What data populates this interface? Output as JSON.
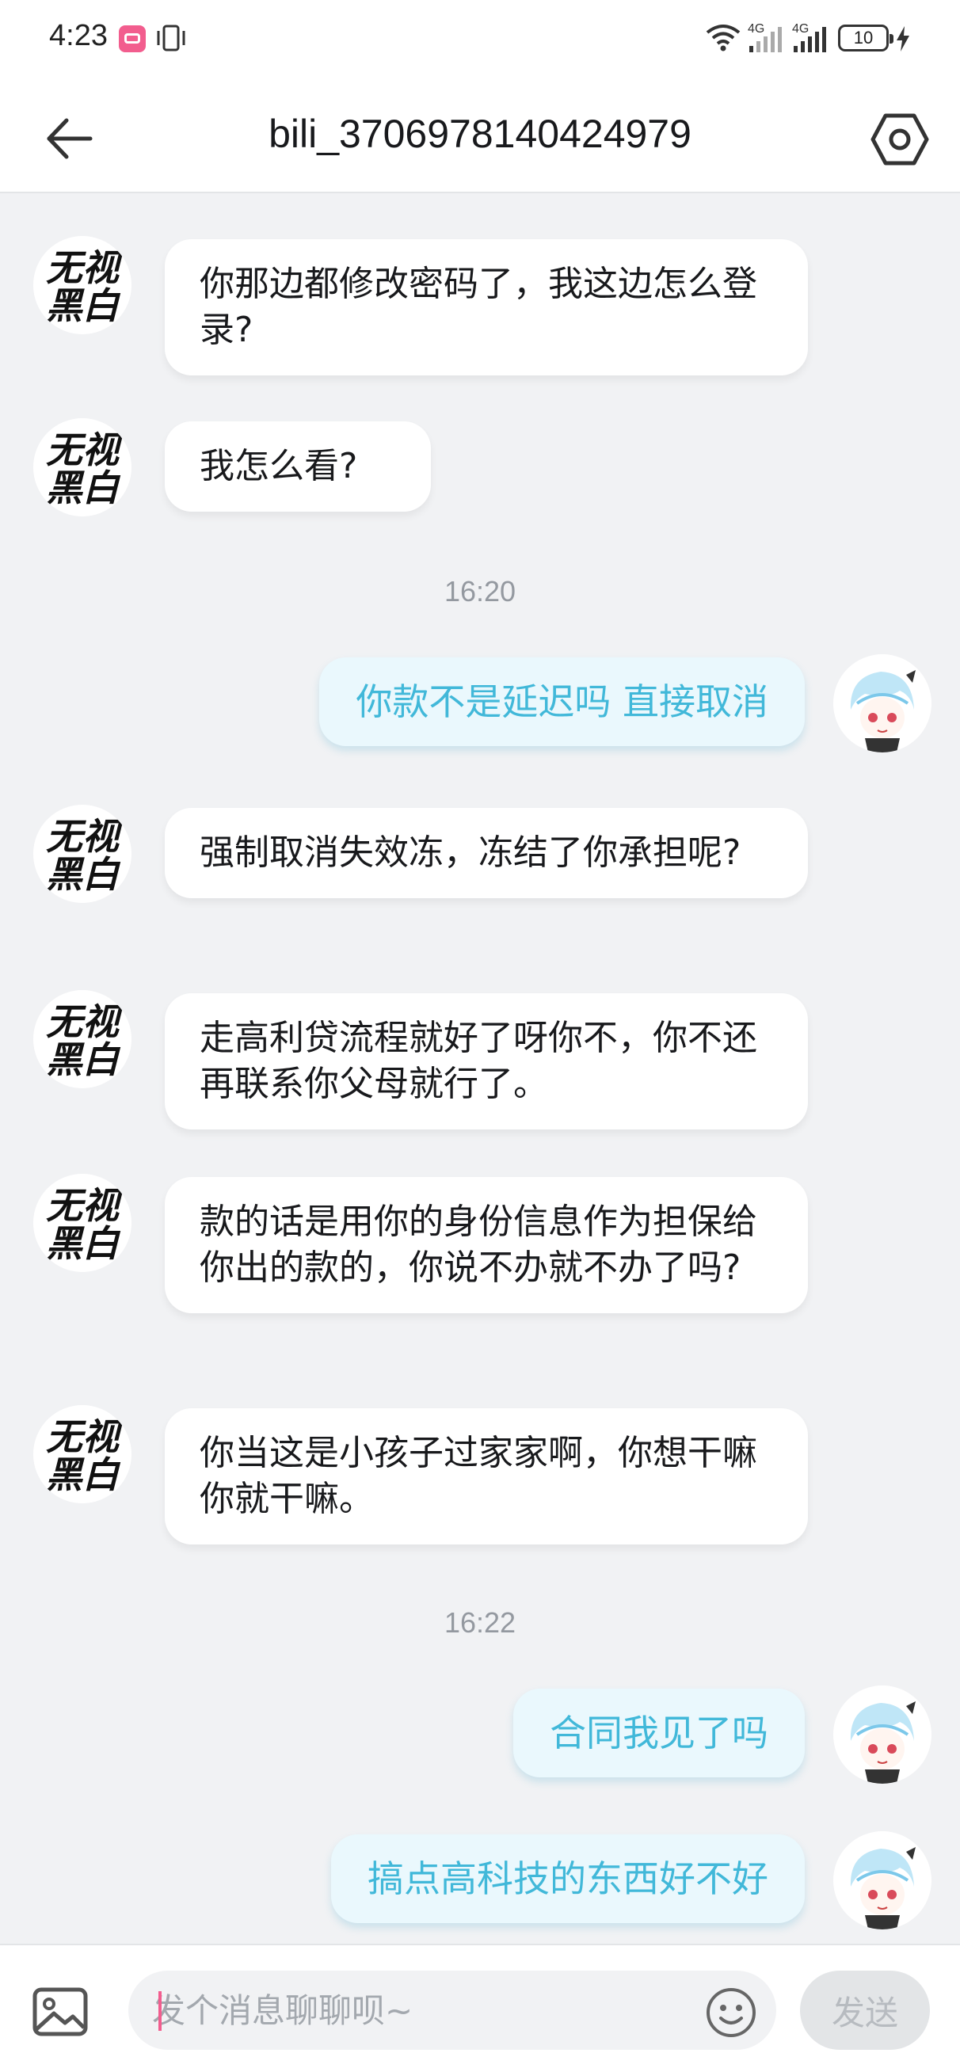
{
  "status_bar": {
    "time": "4:23",
    "network_1": "4G",
    "network_2": "4G",
    "battery": "10"
  },
  "header": {
    "title": "bili_3706978140424979"
  },
  "avatars": {
    "left_text_top": "无视",
    "left_text_bottom": "黑白"
  },
  "messages": [
    {
      "side": "left",
      "text": "你那边都修改密码了，我这边怎么登录?"
    },
    {
      "side": "left",
      "text": "我怎么看?"
    },
    {
      "side": "time",
      "text": "16:20"
    },
    {
      "side": "right",
      "text": "你款不是延迟吗  直接取消"
    },
    {
      "side": "left",
      "text": "强制取消失效冻，冻结了你承担呢?"
    },
    {
      "side": "left",
      "text": "走高利贷流程就好了呀你不，你不还再联系你父母就行了。"
    },
    {
      "side": "left",
      "text": "款的话是用你的身份信息作为担保给你出的款的，你说不办就不办了吗?"
    },
    {
      "side": "left",
      "text": "你当这是小孩子过家家啊，你想干嘛你就干嘛。"
    },
    {
      "side": "time",
      "text": "16:22"
    },
    {
      "side": "right",
      "text": "合同我见了吗"
    },
    {
      "side": "right",
      "text": "搞点高科技的东西好不好"
    }
  ],
  "input": {
    "placeholder": "发个消息聊聊呗~",
    "send_label": "发送"
  },
  "colors": {
    "accent": "#f25d8e",
    "self_bubble": "#eaf8fd",
    "self_text": "#41b8d9"
  }
}
